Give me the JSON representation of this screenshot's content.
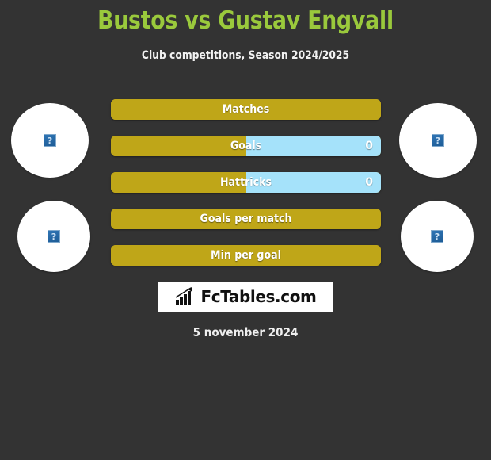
{
  "header": {
    "title": "Bustos vs Gustav Engvall",
    "subtitle": "Club competitions, Season 2024/2025",
    "title_color": "#9ac93c",
    "subtitle_color": "#f2f2f2"
  },
  "colors": {
    "background": "#333333",
    "home_bar": "#bfa618",
    "away_bar": "#a5e2fa",
    "accent_green": "#9ac93c"
  },
  "avatars": [
    {
      "name": "home-player-photo-top",
      "placeholder": "?",
      "side": "left"
    },
    {
      "name": "home-player-photo-bottom",
      "placeholder": "?",
      "side": "left"
    },
    {
      "name": "away-player-photo-top",
      "placeholder": "?",
      "side": "right"
    },
    {
      "name": "away-player-photo-bottom",
      "placeholder": "?",
      "side": "right"
    }
  ],
  "stats": [
    {
      "label": "Matches",
      "home_value": "",
      "away_value": "",
      "home_pct": 100,
      "away_pct": 0
    },
    {
      "label": "Goals",
      "home_value": "",
      "away_value": "0",
      "home_pct": 50,
      "away_pct": 50
    },
    {
      "label": "Hattricks",
      "home_value": "",
      "away_value": "0",
      "home_pct": 50,
      "away_pct": 50
    },
    {
      "label": "Goals per match",
      "home_value": "",
      "away_value": "",
      "home_pct": 100,
      "away_pct": 0
    },
    {
      "label": "Min per goal",
      "home_value": "",
      "away_value": "",
      "home_pct": 100,
      "away_pct": 0
    }
  ],
  "footer": {
    "logo_text": "FcTables.com",
    "logo_icon": "bar-chart-growth-icon",
    "date": "5 november 2024"
  },
  "chart_data": {
    "type": "bar",
    "title": "Bustos vs Gustav Engvall",
    "subtitle": "Club competitions, Season 2024/2025",
    "orientation": "horizontal",
    "categories": [
      "Matches",
      "Goals",
      "Hattricks",
      "Goals per match",
      "Min per goal"
    ],
    "series": [
      {
        "name": "Bustos",
        "values": [
          null,
          null,
          null,
          null,
          null
        ]
      },
      {
        "name": "Gustav Engvall",
        "values": [
          null,
          0,
          0,
          null,
          null
        ]
      }
    ],
    "xlabel": "",
    "ylabel": "",
    "grid": false,
    "legend": "none",
    "notes": "Comparison bars; each bar split left (home, gold) / right (away, light blue). Only Goals and Hattricks show a numeric value of 0 on the away side."
  }
}
